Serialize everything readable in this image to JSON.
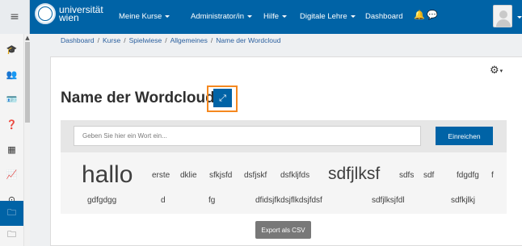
{
  "navbar": {
    "logo_line1": "universität",
    "logo_line2": "wien",
    "items": [
      {
        "label": "Meine Kurse"
      },
      {
        "label": "Administrator/in"
      },
      {
        "label": "Hilfe"
      },
      {
        "label": "Digitale Lehre"
      },
      {
        "label": "Dashboard"
      }
    ],
    "icons": {
      "toggle": "hamburger-icon",
      "bell": "bell-icon",
      "chat": "speech-bubble-icon"
    },
    "bell_glyph": "🔔",
    "chat_glyph": "💬",
    "toggle_glyph": "≡",
    "color": "#0063a6"
  },
  "sidebar": {
    "items": [
      {
        "icon": "graduation-cap-icon",
        "glyph": "🎓"
      },
      {
        "icon": "users-icon",
        "glyph": "👥"
      },
      {
        "icon": "id-card-icon",
        "glyph": "🪪"
      },
      {
        "icon": "help-circle-icon",
        "glyph": "❓"
      },
      {
        "icon": "table-icon",
        "glyph": "▦"
      },
      {
        "icon": "area-chart-icon",
        "glyph": "📈"
      },
      {
        "icon": "compass-icon",
        "glyph": "⊙"
      },
      {
        "icon": "folder-icon",
        "glyph": "🗀",
        "active": true
      },
      {
        "icon": "folder-icon",
        "glyph": "🗀"
      }
    ]
  },
  "breadcrumb": {
    "items": [
      "Dashboard",
      "Kurse",
      "Spielwiese",
      "Allgemeines",
      "Name der Wordcloud"
    ]
  },
  "page": {
    "title": "Name der Wordcloud",
    "gear_glyph": "⚙",
    "expand_glyph": "⤢"
  },
  "form": {
    "placeholder": "Geben Sie hier ein Wort ein...",
    "submit_label": "Einreichen"
  },
  "cloud": {
    "words": [
      {
        "text": "hallo"
      },
      {
        "text": "erste"
      },
      {
        "text": "dklie"
      },
      {
        "text": "sfkjsfd"
      },
      {
        "text": "dsfjskf"
      },
      {
        "text": "dsfkljfds"
      },
      {
        "text": "sdfjlksf"
      },
      {
        "text": "sdfs"
      },
      {
        "text": "sdf"
      },
      {
        "text": "fdgdfg"
      },
      {
        "text": "f"
      },
      {
        "text": "gdfgdgg"
      },
      {
        "text": "d"
      },
      {
        "text": "fg"
      },
      {
        "text": "dfidsjfkdsjflkdsjfdsf"
      },
      {
        "text": "sdfjlksjfdl"
      },
      {
        "text": "sdfkjlkj"
      }
    ]
  },
  "export_label": "Export als CSV",
  "accent_color": "#f5881f"
}
